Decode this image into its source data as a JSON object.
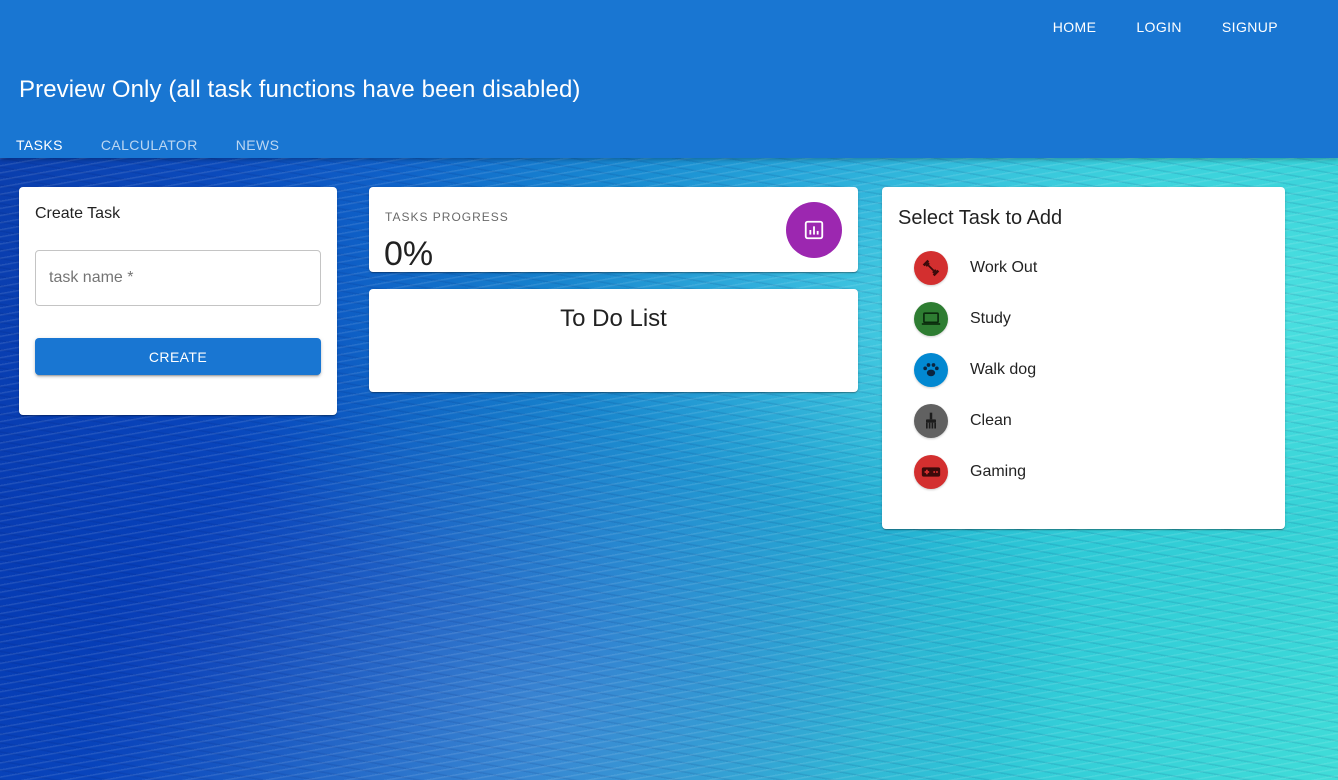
{
  "topnav": {
    "home": "HOME",
    "login": "LOGIN",
    "signup": "SIGNUP"
  },
  "header": {
    "title": "Preview Only (all task functions have been disabled)"
  },
  "tabs": [
    {
      "label": "TASKS",
      "active": true
    },
    {
      "label": "CALCULATOR",
      "active": false
    },
    {
      "label": "NEWS",
      "active": false
    }
  ],
  "create_task": {
    "title": "Create Task",
    "input_placeholder": "task name *",
    "input_value": "",
    "button_label": "CREATE"
  },
  "progress": {
    "label": "TASKS PROGRESS",
    "value": "0%",
    "icon": "bar-chart-icon",
    "color": "#9c27b0"
  },
  "todo": {
    "title": "To Do List",
    "items": []
  },
  "select_task": {
    "title": "Select Task to Add",
    "items": [
      {
        "label": "Work Out",
        "icon": "dumbbell-icon",
        "color": "#d32f2f"
      },
      {
        "label": "Study",
        "icon": "laptop-icon",
        "color": "#2e7d32"
      },
      {
        "label": "Walk dog",
        "icon": "paw-icon",
        "color": "#0288d1"
      },
      {
        "label": "Clean",
        "icon": "broom-icon",
        "color": "#616161"
      },
      {
        "label": "Gaming",
        "icon": "gamepad-icon",
        "color": "#d32f2f"
      }
    ]
  },
  "colors": {
    "primary": "#1976d2"
  }
}
